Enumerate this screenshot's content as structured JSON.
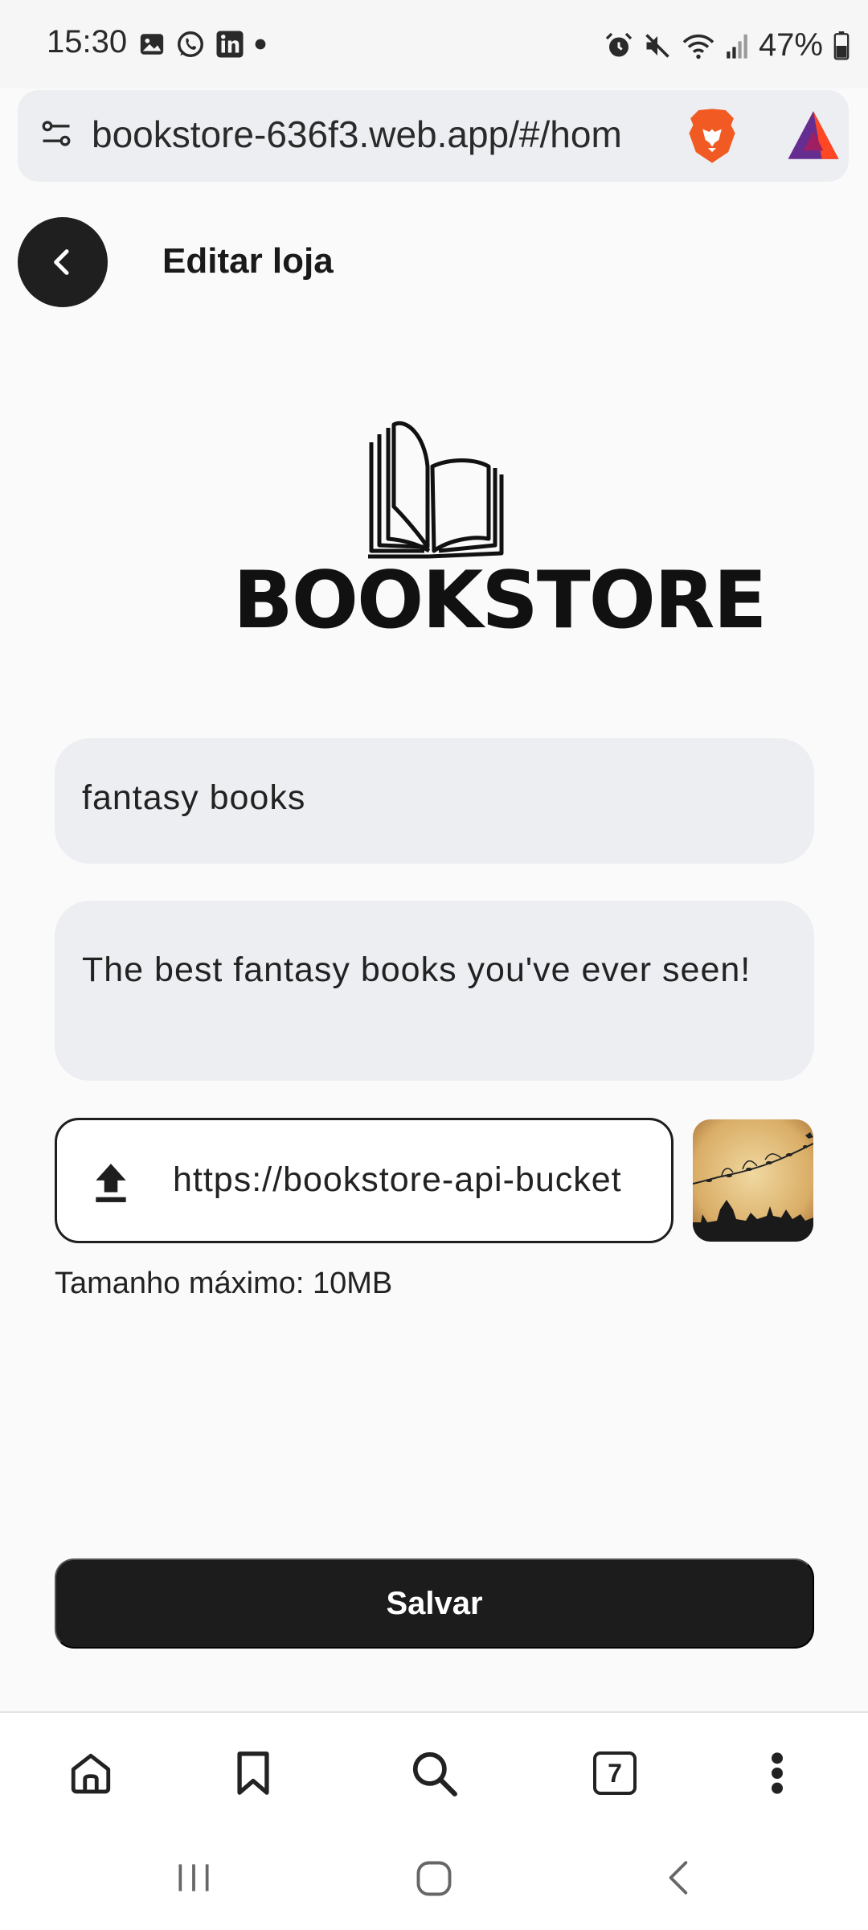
{
  "status_bar": {
    "time": "15:30",
    "battery": "47%",
    "left_icons": [
      "gallery-icon",
      "whatsapp-icon",
      "linkedin-icon",
      "dot-icon"
    ],
    "right_icons": [
      "alarm-icon",
      "mute-icon",
      "wifi-icon",
      "signal-icon",
      "battery-icon"
    ]
  },
  "browser": {
    "url": "bookstore-636f3.web.app/#/hom"
  },
  "header": {
    "title": "Editar loja"
  },
  "logo": {
    "wordmark": "BOOKSTORE"
  },
  "form": {
    "name_value": "fantasy books",
    "description_value": "The best fantasy books you've ever seen!",
    "image_url": "https://bookstore-api-bucket",
    "size_hint": "Tamanho máximo: 10MB",
    "save_label": "Salvar"
  },
  "toolbar": {
    "tab_count": "7",
    "items": [
      "home-icon",
      "bookmark-icon",
      "search-icon",
      "tabs-icon",
      "more-icon"
    ]
  },
  "colors": {
    "primary": "#1c1c1c",
    "field_bg": "#edeef2",
    "background": "#fafafa"
  }
}
